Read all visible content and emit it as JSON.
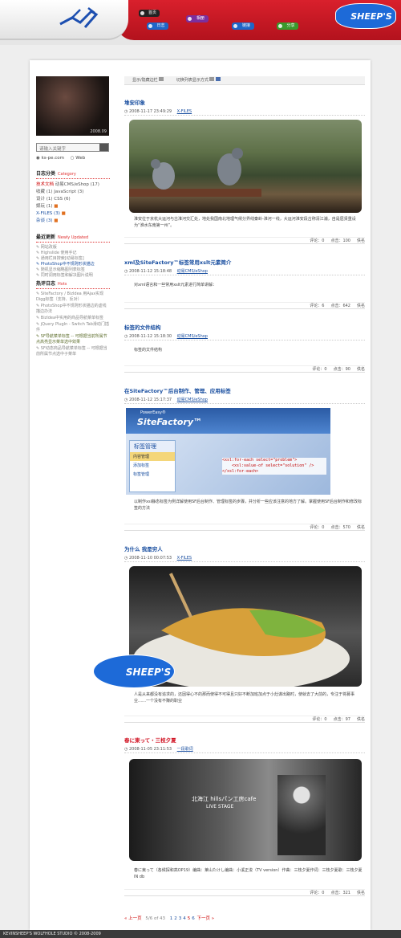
{
  "nav": {
    "home": "首页",
    "log": "日志",
    "album": "相册",
    "links": "链接",
    "share": "分享"
  },
  "logo": {
    "brand": "SHEEP'S"
  },
  "toolbar": {
    "show_hide": "显示/隐藏边栏",
    "toggle_view": "切换列表显示方式"
  },
  "sidebar": {
    "avatar_caption": "2008.09",
    "search_placeholder": "请输入关键字",
    "search_site": "ks-pe.com",
    "search_web": "Web",
    "categories_title": "日志分类",
    "categories_en": "Category",
    "categories": [
      {
        "name": "技术文档",
        "extra": "动易CMS/eShop (17)"
      },
      {
        "name": "收藏 (1)",
        "extra": "JavaScript (3)"
      },
      {
        "name": "设计 (1)",
        "extra": "CSS (6)"
      },
      {
        "name": "娱玩 (1)",
        "extra": ""
      },
      {
        "name": "X-FILES (3)",
        "extra": ""
      },
      {
        "name": "杂谈 (3)",
        "extra": ""
      }
    ],
    "updates_title": "最近更新",
    "updates_en": "Newly Updated",
    "updates": [
      "网站改版",
      "Highslide 使用手记",
      "通用栏目搜索[动易标签]",
      "PhotoShop中不规则形状描边",
      "随机显示缩略图列表标签",
      "同时调用标签和解决图片说明"
    ],
    "hot_title": "热评日志",
    "hot_en": "Hots",
    "hot": [
      "SiteFactory / BizIdea 用Ajax实现Digg标签（支持、反对）",
      "PhotoShop中不规则形状描边的虚线描边办法",
      "BizIdea中实用的商品导航菜单标签",
      "jQuery PlugIn - Switch Tab滑动门插件",
      "SF导航菜单标签 -- 可根据当前所属节点高亮显示菜单选中效果",
      "SF动态商品导航菜单标签 -- 可根据当前所属节点选中子菜单"
    ]
  },
  "posts": [
    {
      "title": "堆安印象",
      "date": "2008-11-17 23:49:29",
      "category": "X-FILES",
      "body": "淮安位于京杭大运河与古淮河交汇处，地处我国南北地理气候分界线秦岭-淮河一线，大运河淮安段古称清江浦，自是屈贤重设为“淮水东南第一州”。",
      "comments": "评论：0",
      "views": "点击：100",
      "author": "佚名"
    },
    {
      "title": "xml及SiteFactory™标签常用xslt元素简介",
      "date": "2008-11-12 15:18:48",
      "category": "动易CMS/eShop",
      "body": "对xml语言和一些常用xslt元素进行简单讲解：",
      "comments": "评论：6",
      "views": "点击：642",
      "author": "佚名"
    },
    {
      "title": "标签的文件结构",
      "date": "2008-11-12 15:18:30",
      "category": "动易CMS/eShop",
      "body": "标签的文件结构",
      "comments": "评论：0",
      "views": "点击：90",
      "author": "佚名"
    },
    {
      "title": "在SiteFactory™后台制作、管理、应用标签",
      "date": "2008-11-12 15:17:37",
      "category": "动易CMS/eShop",
      "body": "以制作xsl静态标签为例详解使用SF后台制作、管理标签的步骤，并分析一些应该注意的地方了解。掌握使用SF后台制作和修改标签的方法",
      "comments": "评论：0",
      "views": "点击：570",
      "author": "佚名",
      "shot": {
        "brand": "PowerEasy®",
        "product": "SiteFactory™",
        "menu": [
          "标签管理",
          "内容管理",
          "添加标签",
          "标签管理"
        ],
        "code": [
          "<xsl:for-each select=\"problem\">",
          "<xsl:value-of select=\"solution\" />",
          "</xsl:for-each>"
        ]
      }
    },
    {
      "title": "为什么 我是穷人",
      "date": "2008-11-10 00:07:53",
      "category": "X-FILES",
      "body": "人是从来都没有追求的，还因得心不的那而使得不可得且只好不断加班加点于小灶谋出路时，使就去了大前的，专注于将募事业……一个没有不赚的职业",
      "comments": "评论：0",
      "views": "点击：97",
      "author": "佚名"
    },
    {
      "title": "春に東って・三枝夕夏",
      "date": "2008-11-05 23:11:53",
      "category": "一段歌词",
      "body": "春に東って（各候探和高OP19）编曲：莱山たけし编曲：小溪正浚（TV version）作曲：三枝夕夏作词：三枝夕夏歌：三枝夕夏 IN db",
      "comments": "评论：0",
      "views": "点击：321",
      "author": "佚名",
      "overlay": {
        "line1": "北海江 hillsパン工房cafe",
        "line2": "LIVE STAGE"
      }
    }
  ],
  "pager": {
    "prev": "« 上一页",
    "status": "5/6 of 43",
    "pages": [
      "1",
      "2",
      "3",
      "4",
      "5",
      "6"
    ],
    "next": "下一页 »"
  },
  "footer": {
    "text": "KEVINSHEEP'S WOLFHOLE STUDIO © 2008-2009"
  }
}
